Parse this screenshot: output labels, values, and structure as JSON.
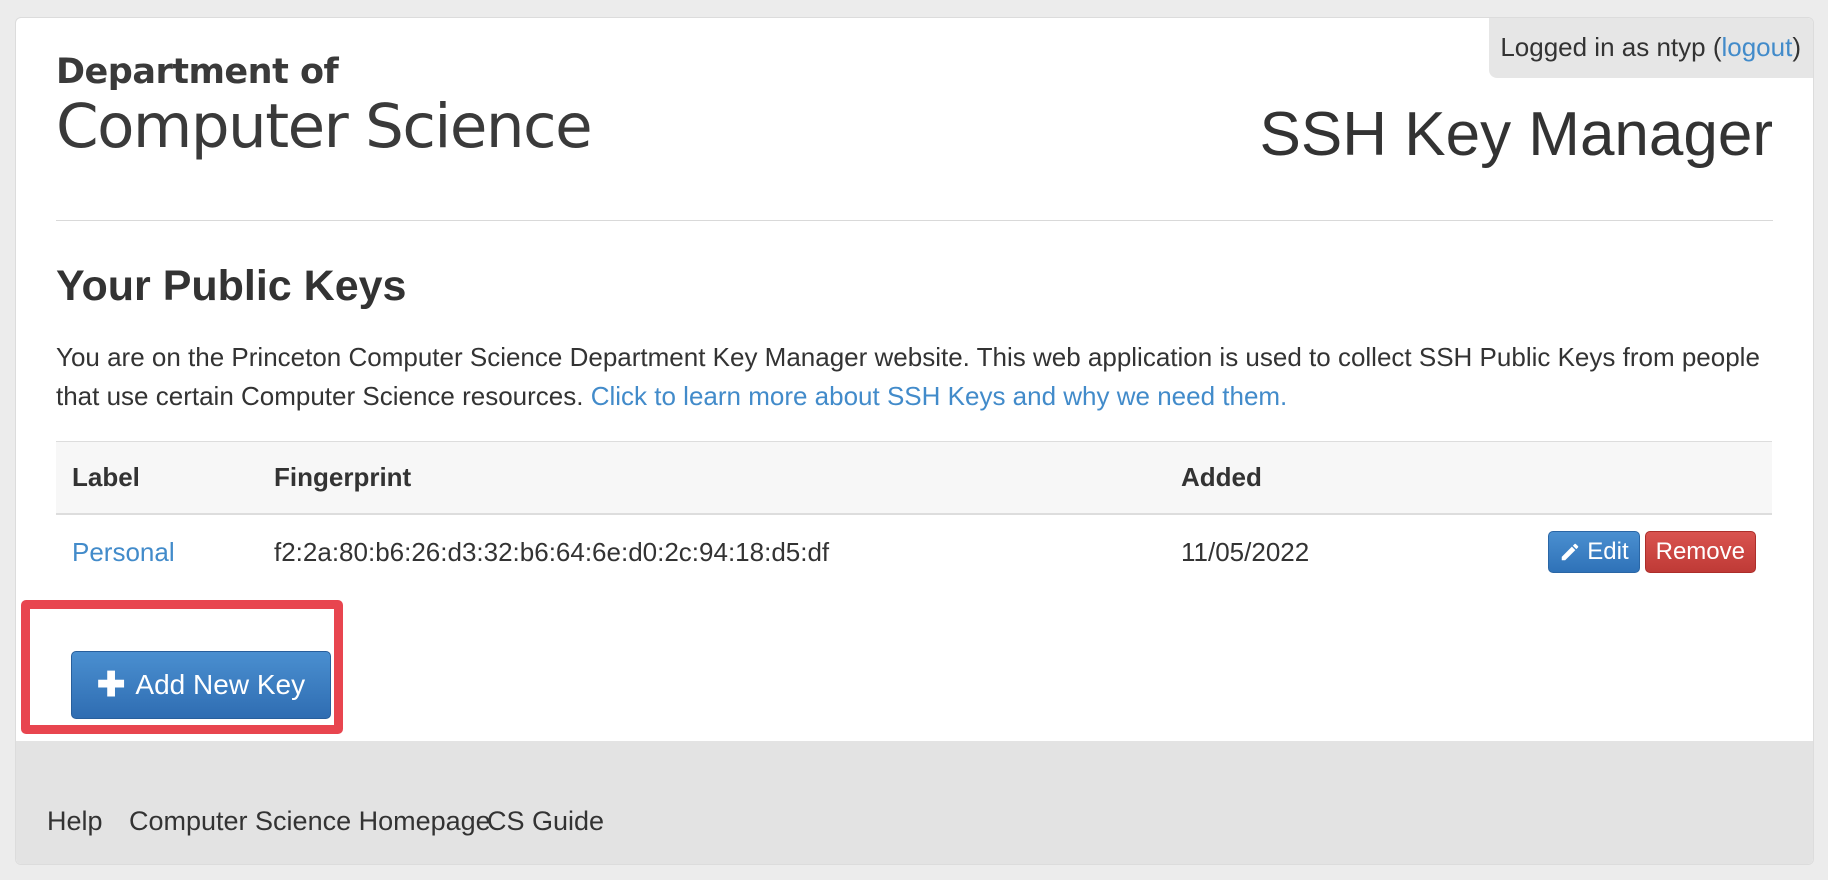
{
  "header": {
    "login_prefix": "Logged in as ntyp (",
    "logout_label": "logout",
    "login_suffix": ")",
    "logo_line1": "Department of",
    "logo_line2": "Computer Science",
    "app_title": "SSH Key Manager"
  },
  "main": {
    "section_title": "Your Public Keys",
    "intro_text": "You are on the Princeton Computer Science Department Key Manager website. This web application is used to collect SSH Public Keys from people that use certain Computer Science resources.",
    "intro_link": "Click to learn more about SSH Keys and why we need them.",
    "table": {
      "columns": [
        "Label",
        "Fingerprint",
        "Added"
      ],
      "rows": [
        {
          "label": "Personal",
          "fingerprint": "f2:2a:80:b6:26:d3:32:b6:64:6e:d0:2c:94:18:d5:df",
          "added": "11/05/2022",
          "edit_label": "Edit",
          "remove_label": "Remove"
        }
      ]
    },
    "add_key_label": "Add New Key"
  },
  "footer": {
    "links": [
      "Help",
      "Computer Science Homepage",
      "CS Guide"
    ]
  },
  "colors": {
    "link": "#428bca",
    "primary_button": "#337ab7",
    "danger_button": "#d9534f",
    "highlight_box": "#e8454f"
  },
  "icons": {
    "edit": "pencil-icon",
    "add": "plus-icon"
  }
}
